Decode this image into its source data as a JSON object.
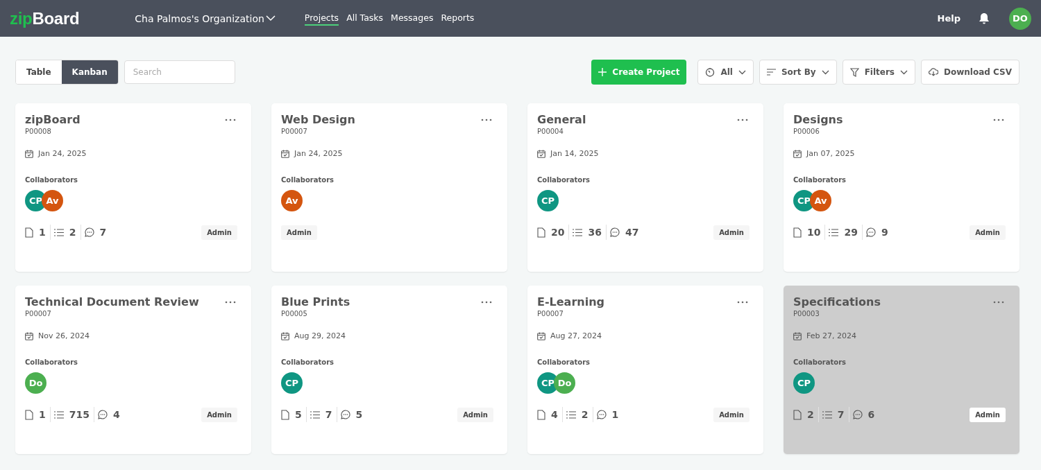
{
  "header": {
    "logo": {
      "part1": "zip",
      "part2": "Board"
    },
    "organization": "Cha Palmos's Organization",
    "nav": [
      {
        "label": "Projects",
        "selected": true
      },
      {
        "label": "All Tasks",
        "selected": false
      },
      {
        "label": "Messages",
        "selected": false
      },
      {
        "label": "Reports",
        "selected": false
      }
    ],
    "help": "Help",
    "user_initials": "DO"
  },
  "toolbar": {
    "views": [
      {
        "label": "Table",
        "selected": false
      },
      {
        "label": "Kanban",
        "selected": true
      }
    ],
    "search": {
      "placeholder": "Search"
    },
    "create_button": "Create Project",
    "time_filter": "All",
    "sort": "Sort By",
    "filters": "Filters",
    "download": "Download CSV"
  },
  "projects": [
    {
      "name": "zipBoard",
      "code": "P00008",
      "date": "Jan 24, 2025",
      "collaborators_label": "Collaborators",
      "collaborators": [
        {
          "initials": "CP",
          "color": "#0f9682"
        },
        {
          "initials": "Av",
          "color": "#d4550f"
        }
      ],
      "stats": {
        "files": "1",
        "tasks": "2",
        "comments": "7"
      },
      "role": "Admin",
      "disabled": false
    },
    {
      "name": "Web Design",
      "code": "P00007",
      "date": "Jan 24, 2025",
      "collaborators_label": "Collaborators",
      "collaborators": [
        {
          "initials": "Av",
          "color": "#d4550f"
        }
      ],
      "role": "Admin",
      "disabled": false
    },
    {
      "name": "General",
      "code": "P00004",
      "date": "Jan 14, 2025",
      "collaborators_label": "Collaborators",
      "collaborators": [
        {
          "initials": "CP",
          "color": "#0f9682"
        }
      ],
      "stats": {
        "files": "20",
        "tasks": "36",
        "comments": "47"
      },
      "role": "Admin",
      "disabled": false
    },
    {
      "name": "Designs",
      "code": "P00006",
      "date": "Jan 07, 2025",
      "collaborators_label": "Collaborators",
      "collaborators": [
        {
          "initials": "CP",
          "color": "#0f9682"
        },
        {
          "initials": "Av",
          "color": "#d4550f"
        }
      ],
      "stats": {
        "files": "10",
        "tasks": "29",
        "comments": "9"
      },
      "role": "Admin",
      "disabled": false
    },
    {
      "name": "Technical Document Review",
      "code": "P00007",
      "date": "Nov 26, 2024",
      "collaborators_label": "Collaborators",
      "collaborators": [
        {
          "initials": "Do",
          "color": "#4caf50"
        }
      ],
      "stats": {
        "files": "1",
        "tasks": "715",
        "comments": "4"
      },
      "role": "Admin",
      "disabled": false
    },
    {
      "name": "Blue Prints",
      "code": "P00005",
      "date": "Aug 29, 2024",
      "collaborators_label": "Collaborators",
      "collaborators": [
        {
          "initials": "CP",
          "color": "#0f9682"
        }
      ],
      "stats": {
        "files": "5",
        "tasks": "7",
        "comments": "5"
      },
      "role": "Admin",
      "disabled": false
    },
    {
      "name": "E-Learning",
      "code": "P00007",
      "date": "Aug 27, 2024",
      "collaborators_label": "Collaborators",
      "collaborators": [
        {
          "initials": "CP",
          "color": "#0f9682"
        },
        {
          "initials": "Do",
          "color": "#4caf50"
        }
      ],
      "stats": {
        "files": "4",
        "tasks": "2",
        "comments": "1"
      },
      "role": "Admin",
      "disabled": false
    },
    {
      "name": "Specifications",
      "code": "P00003",
      "date": "Feb 27, 2024",
      "collaborators_label": "Collaborators",
      "collaborators": [
        {
          "initials": "CP",
          "color": "#0f9682"
        }
      ],
      "stats": {
        "files": "2",
        "tasks": "7",
        "comments": "6"
      },
      "role": "Admin",
      "disabled": true
    }
  ]
}
